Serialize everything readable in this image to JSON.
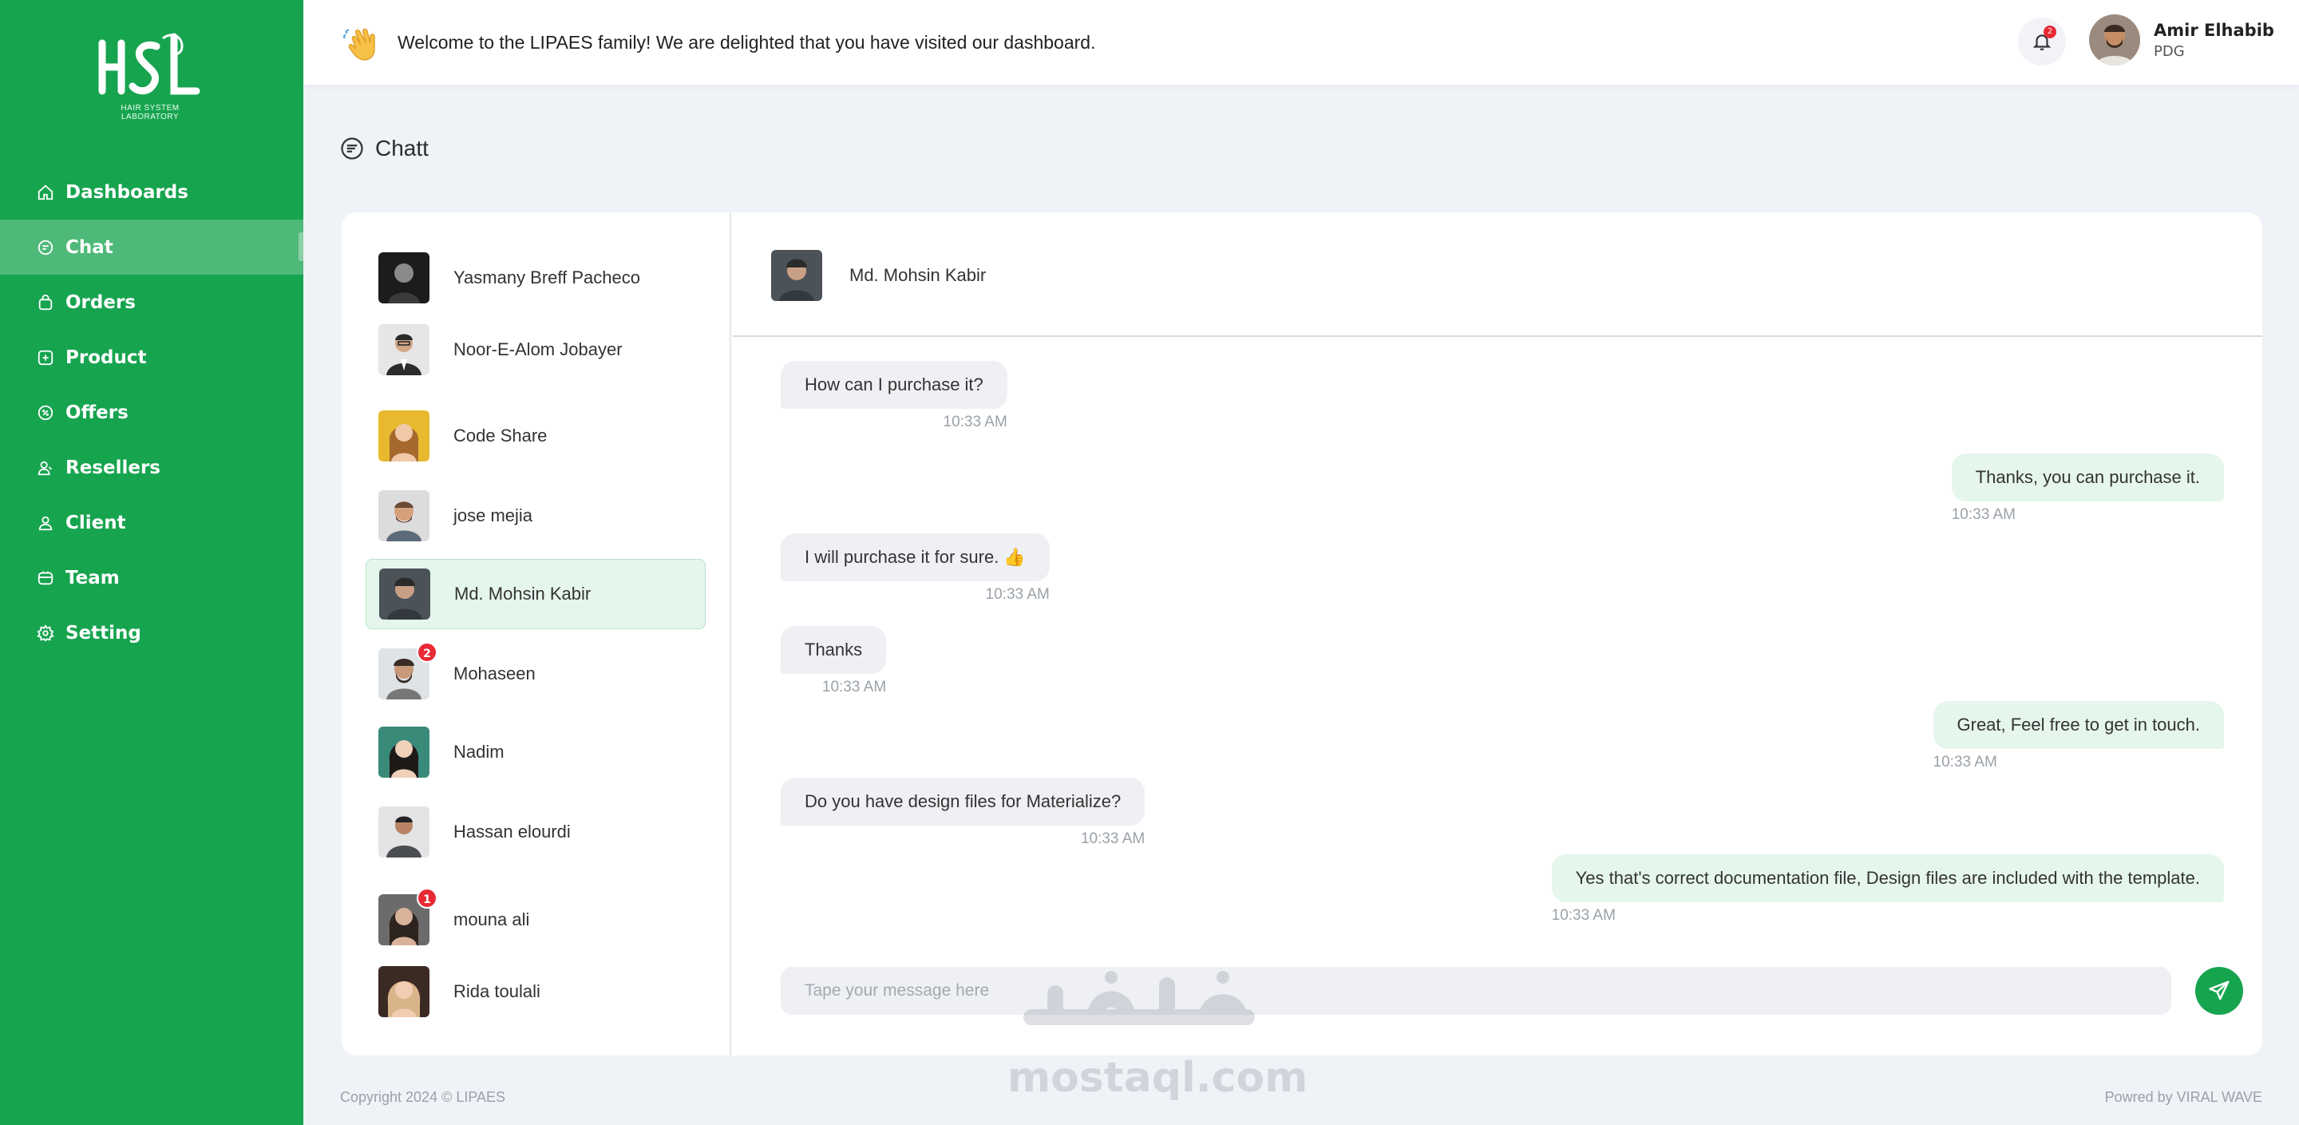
{
  "sidebar": {
    "logo_text": "HSL",
    "logo_sub": "HAIR SYSTEM LABORATORY",
    "items": [
      {
        "label": "Dashboards",
        "icon": "home-icon"
      },
      {
        "label": "Chat",
        "icon": "chat-icon",
        "active": true
      },
      {
        "label": "Orders",
        "icon": "bag-icon"
      },
      {
        "label": "Product",
        "icon": "plus-box-icon"
      },
      {
        "label": "Offers",
        "icon": "tag-circle-icon"
      },
      {
        "label": "Resellers",
        "icon": "users-icon"
      },
      {
        "label": "Client",
        "icon": "user-icon"
      },
      {
        "label": "Team",
        "icon": "team-icon"
      },
      {
        "label": "Setting",
        "icon": "gear-icon"
      }
    ]
  },
  "topbar": {
    "welcome": "Welcome to the LIPAES family! We are delighted that you have visited our dashboard.",
    "notification_count": "2",
    "user_name": "Amir Elhabib",
    "user_role": "PDG"
  },
  "page": {
    "title": "Chatt"
  },
  "contacts": [
    {
      "name": "Yasmany Breff Pacheco"
    },
    {
      "name": "Noor-E-Alom Jobayer"
    },
    {
      "name": "Code Share"
    },
    {
      "name": "jose mejia"
    },
    {
      "name": "Md. Mohsin Kabir",
      "active": true
    },
    {
      "name": "Mohaseen",
      "badge": "2"
    },
    {
      "name": "Nadim"
    },
    {
      "name": "Hassan elourdi"
    },
    {
      "name": "mouna ali",
      "badge": "1"
    },
    {
      "name": "Rida toulali"
    }
  ],
  "conversation": {
    "contact_name": "Md. Mohsin Kabir",
    "messages": [
      {
        "direction": "in",
        "text": "How can I purchase it?",
        "time": "10:33 AM"
      },
      {
        "direction": "out",
        "text": "Thanks, you can purchase it.",
        "time": "10:33 AM"
      },
      {
        "direction": "in",
        "text": "I will purchase it for sure. 👍",
        "time": "10:33 AM"
      },
      {
        "direction": "in",
        "text": "Thanks",
        "time": "10:33 AM"
      },
      {
        "direction": "out",
        "text": "Great, Feel free to get in touch.",
        "time": "10:33 AM"
      },
      {
        "direction": "in",
        "text": "Do you have design files for Materialize?",
        "time": "10:33 AM"
      },
      {
        "direction": "out",
        "text": "Yes that's correct documentation file, Design files are included with the template.",
        "time": "10:33 AM"
      }
    ],
    "input_placeholder": "Tape your message here"
  },
  "footer": {
    "copyright": "Copyright 2024 © LIPAES",
    "powered": "Powred by VIRAL WAVE"
  },
  "watermark": {
    "text": "mostaql.com"
  },
  "colors": {
    "brand_green": "#17a44f",
    "bubble_out": "#e5f6ec",
    "bubble_in": "#eef0f3",
    "badge_red": "#e82a35"
  }
}
